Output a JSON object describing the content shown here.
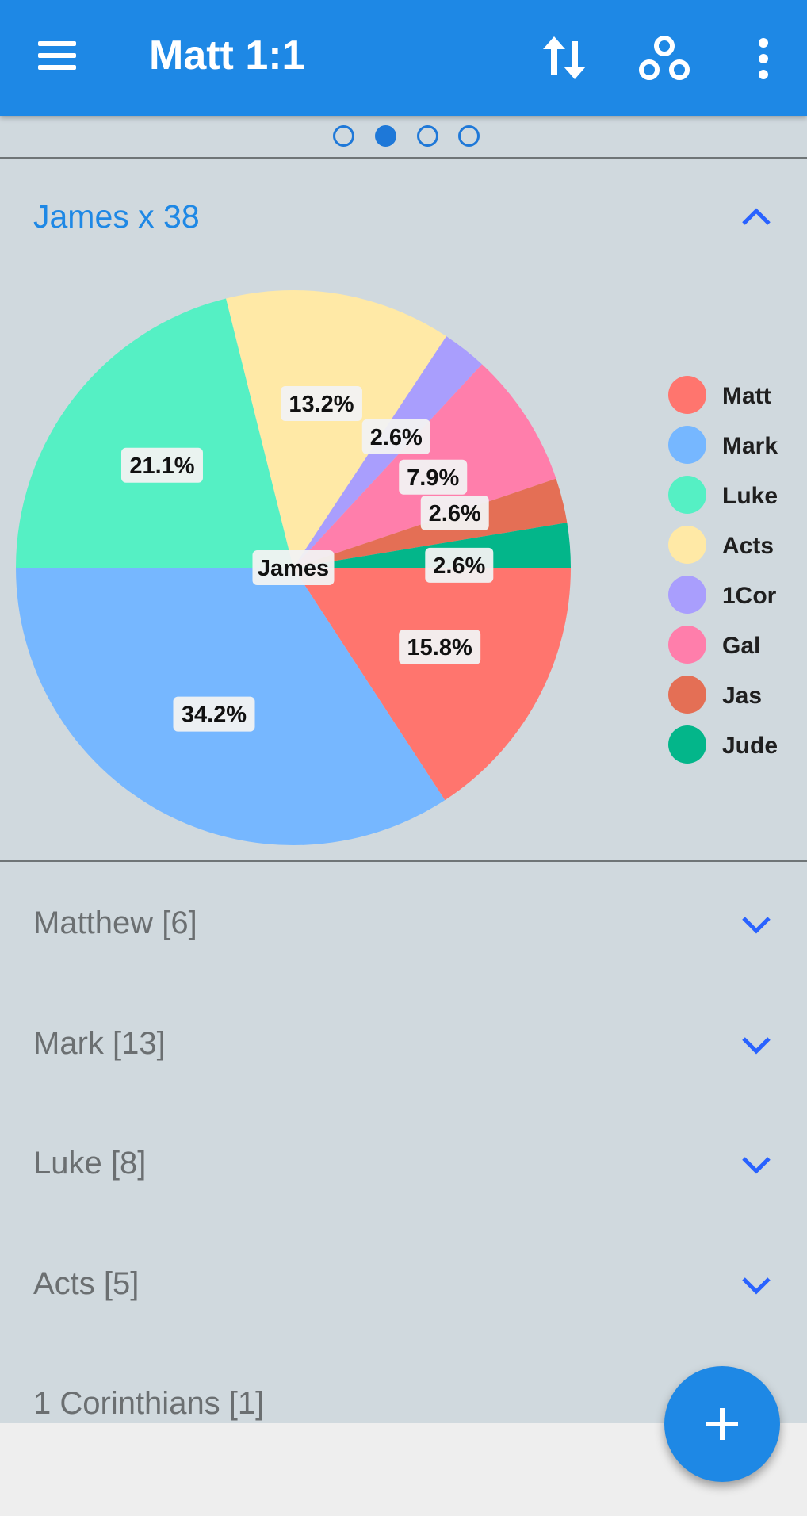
{
  "appbar": {
    "title": "Matt 1:1",
    "icons": [
      "menu-icon",
      "swap-vertical-icon",
      "share-nodes-icon",
      "more-vert-icon"
    ]
  },
  "pager": {
    "count": 4,
    "active": 1
  },
  "section": {
    "title": "James x 38"
  },
  "chart_data": {
    "type": "pie",
    "center_label": "James",
    "slices": [
      {
        "name": "Matt",
        "value": 15.8,
        "label": "15.8%",
        "color": "#ff756e"
      },
      {
        "name": "Mark",
        "value": 34.2,
        "label": "34.2%",
        "color": "#76b7ff"
      },
      {
        "name": "Luke",
        "value": 21.1,
        "label": "21.1%",
        "color": "#55f0c4"
      },
      {
        "name": "Acts",
        "value": 13.2,
        "label": "13.2%",
        "color": "#ffe9a6"
      },
      {
        "name": "1Cor",
        "value": 2.6,
        "label": "2.6%",
        "color": "#a99efd"
      },
      {
        "name": "Gal",
        "value": 7.9,
        "label": "7.9%",
        "color": "#ff7eab"
      },
      {
        "name": "Jas",
        "value": 2.6,
        "label": "2.6%",
        "color": "#e46f55"
      },
      {
        "name": "Jude",
        "value": 2.6,
        "label": "2.6%",
        "color": "#03b68a"
      }
    ],
    "legend": [
      "Matt",
      "Mark",
      "Luke",
      "Acts",
      "1Cor",
      "Gal",
      "Jas",
      "Jude"
    ],
    "legend_position": "right"
  },
  "list": [
    {
      "label": "Matthew [6]"
    },
    {
      "label": "Mark [13]"
    },
    {
      "label": "Luke [8]"
    },
    {
      "label": "Acts [5]"
    },
    {
      "label": "1 Corinthians [1]"
    }
  ],
  "colors": {
    "appbar": "#1e88e5",
    "background": "#d0d9de",
    "accent": "#1e88e5",
    "chevron": "#2962ff"
  },
  "fab": {
    "icon": "plus-icon"
  }
}
